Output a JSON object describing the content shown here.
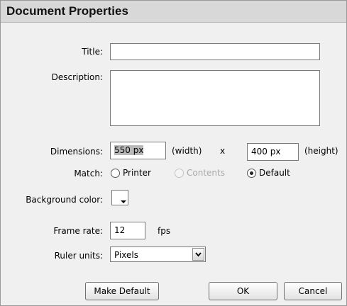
{
  "window": {
    "title": "Document Properties"
  },
  "title_field": {
    "label": "Title:",
    "value": ""
  },
  "description_field": {
    "label": "Description:",
    "value": ""
  },
  "dimensions": {
    "label": "Dimensions:",
    "width_value": "550 px",
    "width_unit": "(width)",
    "separator": "x",
    "height_value": "400 px",
    "height_unit": "(height)"
  },
  "match": {
    "label": "Match:",
    "options": [
      {
        "label": "Printer",
        "selected": false,
        "enabled": true
      },
      {
        "label": "Contents",
        "selected": false,
        "enabled": false
      },
      {
        "label": "Default",
        "selected": true,
        "enabled": true
      }
    ]
  },
  "background_color": {
    "label": "Background color:",
    "value": "#ffffff"
  },
  "frame_rate": {
    "label": "Frame rate:",
    "value": "12",
    "unit": "fps"
  },
  "ruler_units": {
    "label": "Ruler units:",
    "value": "Pixels"
  },
  "buttons": {
    "make_default": "Make Default",
    "ok": "OK",
    "cancel": "Cancel"
  }
}
